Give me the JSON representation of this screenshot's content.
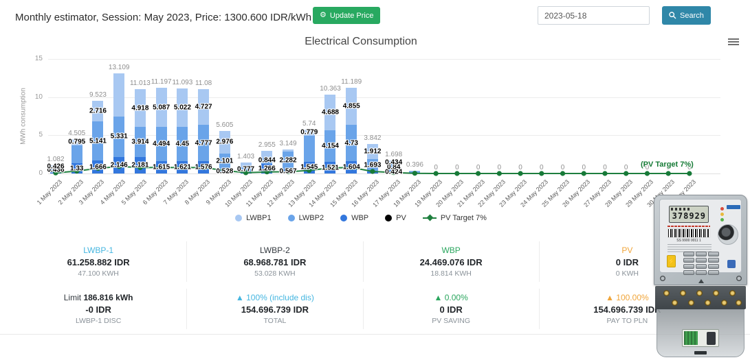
{
  "header": {
    "title": "Monthly estimator, Session: May 2023, Price: 1300.600 IDR/kWh",
    "update_button_label": "Update Price",
    "update_button_color": "#28a960",
    "date_value": "2023-05-18",
    "search_label": "Search",
    "search_button_color": "#2f87a8"
  },
  "chart_data": {
    "type": "bar",
    "stacked": true,
    "title": "Electrical Consumption",
    "ylabel": "MWh consumption",
    "xlabel": "",
    "ylim": [
      0,
      15
    ],
    "y_ticks": [
      0,
      5,
      10,
      15
    ],
    "grid": true,
    "legend_position": "bottom",
    "line_end_label": "(PV Target 7%)",
    "categories": [
      "1 May 2023",
      "2 May 2023",
      "3 May 2023",
      "4 May 2023",
      "5 May 2023",
      "6 May 2023",
      "7 May 2023",
      "8 May 2023",
      "9 May 2023",
      "10 May 2023",
      "11 May 2023",
      "12 May 2023",
      "13 May 2023",
      "14 May 2023",
      "15 May 2023",
      "16 May 2023",
      "17 May 2023",
      "18 May 2023",
      "19 May 2023",
      "20 May 2023",
      "21 May 2023",
      "22 May 2023",
      "23 May 2023",
      "24 May 2023",
      "25 May 2023",
      "26 May 2023",
      "27 May 2023",
      "28 May 2023",
      "29 May 2023",
      "30 May 2023",
      "31 May 2023"
    ],
    "totals_labels": [
      "1.082",
      "4.505",
      "9.523",
      "13.109",
      "11.013",
      "11.197",
      "11.093",
      "11.08",
      "5.605",
      "1.403",
      "2.955",
      "3.149",
      "5.74",
      "10.363",
      "11.189",
      "3.842",
      "1.698",
      "0.396",
      "0",
      "0",
      "0",
      "0",
      "0",
      "0",
      "0",
      "0",
      "0",
      "0",
      "0",
      "0",
      "0"
    ],
    "series": [
      {
        "name": "LWBP1",
        "color": "#a8c8f2",
        "marker": "circle",
        "values": [
          0.426,
          0.795,
          2.716,
          5.632,
          4.918,
          5.087,
          5.022,
          4.727,
          2.976,
          0.476,
          0.845,
          0.3,
          0.779,
          4.688,
          4.855,
          1.912,
          0.434,
          0.13,
          0,
          0,
          0,
          0,
          0,
          0,
          0,
          0,
          0,
          0,
          0,
          0,
          0
        ],
        "labels": [
          "0.426",
          "0.795",
          "2.716",
          "",
          "4.918",
          "5.087",
          "5.022",
          "4.727",
          "2.976",
          "",
          "",
          "",
          "0.779",
          "4.688",
          "4.855",
          "1.912",
          "0.434",
          "",
          "",
          "",
          "",
          "",
          "",
          "",
          "",
          "",
          "",
          "",
          "",
          "",
          ""
        ]
      },
      {
        "name": "LWBP2",
        "color": "#6aa4e9",
        "marker": "circle",
        "values": [
          0.436,
          2.38,
          5.141,
          5.331,
          3.914,
          4.494,
          4.45,
          4.777,
          2.101,
          0.777,
          0.844,
          2.282,
          3.416,
          4.154,
          4.73,
          1.693,
          0.84,
          0.2,
          0,
          0,
          0,
          0,
          0,
          0,
          0,
          0,
          0,
          0,
          0,
          0,
          0
        ],
        "labels": [
          "0.436",
          "",
          "5.141",
          "5.331",
          "3.914",
          "4.494",
          "4.45",
          "4.777",
          "2.101",
          "0.777",
          "0.844",
          "2.282",
          "",
          "4.154",
          "4.73",
          "1.693",
          "0.84",
          "",
          "",
          "",
          "",
          "",
          "",
          "",
          "",
          "",
          "",
          "",
          "",
          "",
          ""
        ]
      },
      {
        "name": "WBP",
        "color": "#3377dd",
        "marker": "circle",
        "values": [
          0.22,
          1.33,
          1.666,
          2.146,
          2.181,
          1.616,
          1.621,
          1.576,
          0.528,
          0.15,
          1.266,
          0.567,
          1.545,
          1.521,
          1.604,
          0.237,
          0.424,
          0.066,
          0,
          0,
          0,
          0,
          0,
          0,
          0,
          0,
          0,
          0,
          0,
          0,
          0
        ],
        "labels": [
          "",
          "1.33",
          "1.666",
          "2.146",
          "2.181",
          "1.615",
          "1.621",
          "1.576",
          "0.528",
          "",
          "1.266",
          "0.567",
          "1.545",
          "1.521",
          "1.604",
          "",
          "0.424",
          "",
          "",
          "",
          "",
          "",
          "",
          "",
          "",
          "",
          "",
          "",
          "",
          "",
          ""
        ]
      },
      {
        "name": "PV",
        "color": "#000000",
        "marker": "circle",
        "values": [
          0,
          0,
          0,
          0,
          0,
          0,
          0,
          0,
          0,
          0,
          0,
          0,
          0,
          0,
          0,
          0,
          0,
          0,
          0,
          0,
          0,
          0,
          0,
          0,
          0,
          0,
          0,
          0,
          0,
          0,
          0
        ],
        "labels": [
          "",
          "",
          "",
          "",
          "",
          "",
          "",
          "",
          "",
          "",
          "",
          "",
          "",
          "",
          "",
          "",
          "",
          "",
          "",
          "",
          "",
          "",
          "",
          "",
          "",
          "",
          "",
          "",
          "",
          "",
          ""
        ]
      },
      {
        "name": "PV Target 7%",
        "color": "#1e7f3e",
        "type": "line",
        "marker": "line-diamond",
        "values": [
          0.076,
          0.315,
          0.667,
          0.918,
          0.771,
          0.784,
          0.776,
          0.776,
          0.392,
          0.098,
          0.207,
          0.22,
          0.402,
          0.725,
          0.783,
          0.269,
          0.119,
          0.028,
          0,
          0,
          0,
          0,
          0,
          0,
          0,
          0,
          0,
          0,
          0,
          0,
          0
        ],
        "labels": [
          "",
          "",
          "",
          "",
          "",
          "",
          "",
          "",
          "",
          "",
          "",
          "",
          "",
          "",
          "",
          "",
          "",
          "",
          "",
          "",
          "",
          "",
          "",
          "",
          "",
          "",
          "",
          "",
          "",
          "",
          ""
        ]
      }
    ]
  },
  "cards": {
    "row1": [
      {
        "title": "LWBP-1",
        "value": "61.258.882 IDR",
        "sub": "47.100 KWH",
        "title_color": "#45b6e0"
      },
      {
        "title": "LWBP-2",
        "value": "68.968.781 IDR",
        "sub": "53.028 KWH",
        "title_color": "#32383e"
      },
      {
        "title": "WBP",
        "value": "24.469.076 IDR",
        "sub": "18.814 KWH",
        "title_color": "#2aa65e"
      },
      {
        "title": "PV",
        "value": "0 IDR",
        "sub": "0 KWH",
        "title_color": "#f0a53a"
      }
    ],
    "row2": [
      {
        "prefix": "Limit",
        "bold": "186.816 kWh",
        "value": "-0 IDR",
        "sub": "LWBP-1 DISC",
        "title_color": "#32383e"
      },
      {
        "title": "▲ 100% (include dis)",
        "value": "154.696.739 IDR",
        "sub": "TOTAL",
        "title_color": "#45b6e0"
      },
      {
        "title": "▲ 0.00%",
        "value": "0 IDR",
        "sub": "PV SAVING",
        "title_color": "#2aa65e"
      },
      {
        "title": "▲ 100.00%",
        "value": "154.696.739 IDR",
        "sub": "PAY TO PLN",
        "title_color": "#f0a53a"
      }
    ]
  },
  "meter": {
    "lcd_value": "378929",
    "barcode_text": "SS 9900 0011 1"
  }
}
